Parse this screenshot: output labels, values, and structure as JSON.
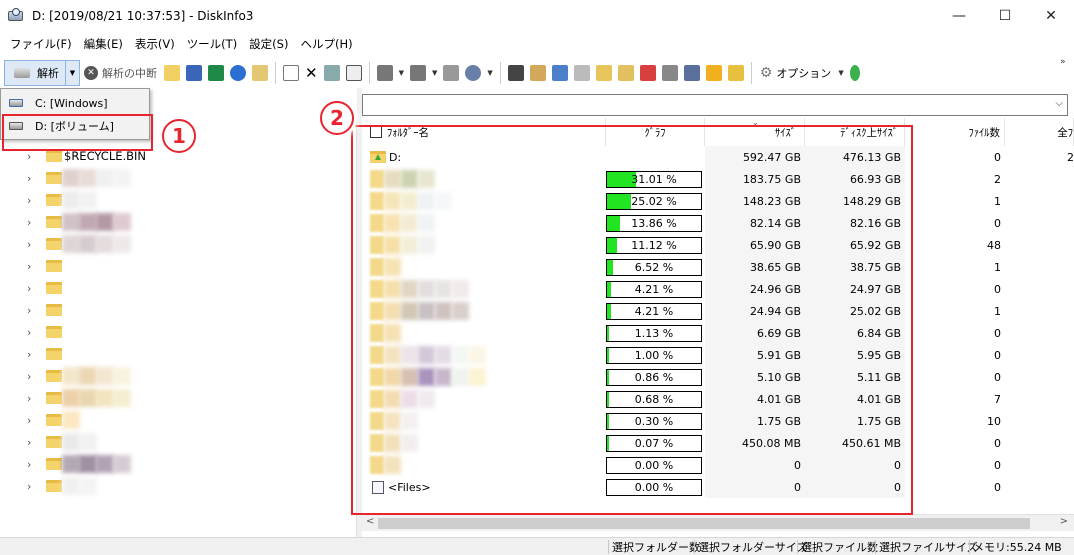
{
  "window": {
    "title": "D: [2019/08/21 10:37:53] - DiskInfo3",
    "minimize": "—",
    "maximize": "☐",
    "close": "✕"
  },
  "menu": [
    "ファイル(F)",
    "編集(E)",
    "表示(V)",
    "ツール(T)",
    "設定(S)",
    "ヘルプ(H)"
  ],
  "toolbar": {
    "analyze": "解析",
    "stop": "解析の中断",
    "options": "オプション"
  },
  "drive_menu": {
    "items": [
      "C: [Windows]",
      "D: [ボリューム]"
    ]
  },
  "annotations": {
    "one": "1",
    "two": "2"
  },
  "tree": {
    "items": [
      {
        "label": "$RECYCLE.BIN"
      }
    ]
  },
  "list": {
    "columns": {
      "name": "ﾌｫﾙﾀﾞｰ名",
      "graph": "ｸﾞﾗﾌ",
      "size": "ｻｲｽﾞ",
      "disk": "ﾃﾞｨｽｸ上ｻｲｽﾞ",
      "files": "ﾌｧｲﾙ数",
      "total": "全ﾌ"
    },
    "root": {
      "name": "D:",
      "size": "592.47 GB",
      "disk": "476.13 GB",
      "files": "0",
      "total": "2"
    },
    "rows": [
      {
        "percent": 31.01,
        "graph": "31.01 %",
        "size": "183.75 GB",
        "disk": "66.93 GB",
        "files": "2",
        "total": ""
      },
      {
        "percent": 25.02,
        "graph": "25.02 %",
        "size": "148.23 GB",
        "disk": "148.29 GB",
        "files": "1",
        "total": ""
      },
      {
        "percent": 13.86,
        "graph": "13.86 %",
        "size": "82.14 GB",
        "disk": "82.16 GB",
        "files": "0",
        "total": ""
      },
      {
        "percent": 11.12,
        "graph": "11.12 %",
        "size": "65.90 GB",
        "disk": "65.92 GB",
        "files": "48",
        "total": ""
      },
      {
        "percent": 6.52,
        "graph": "6.52 %",
        "size": "38.65 GB",
        "disk": "38.75 GB",
        "files": "1",
        "total": ""
      },
      {
        "percent": 4.21,
        "graph": "4.21 %",
        "size": "24.96 GB",
        "disk": "24.97 GB",
        "files": "0",
        "total": ""
      },
      {
        "percent": 4.21,
        "graph": "4.21 %",
        "size": "24.94 GB",
        "disk": "25.02 GB",
        "files": "1",
        "total": ""
      },
      {
        "percent": 1.13,
        "graph": "1.13 %",
        "size": "6.69 GB",
        "disk": "6.84 GB",
        "files": "0",
        "total": ""
      },
      {
        "percent": 1.0,
        "graph": "1.00 %",
        "size": "5.91 GB",
        "disk": "5.95 GB",
        "files": "0",
        "total": ""
      },
      {
        "percent": 0.86,
        "graph": "0.86 %",
        "size": "5.10 GB",
        "disk": "5.11 GB",
        "files": "0",
        "total": ""
      },
      {
        "percent": 0.68,
        "graph": "0.68 %",
        "size": "4.01 GB",
        "disk": "4.01 GB",
        "files": "7",
        "total": ""
      },
      {
        "percent": 0.3,
        "graph": "0.30 %",
        "size": "1.75 GB",
        "disk": "1.75 GB",
        "files": "10",
        "total": ""
      },
      {
        "percent": 0.07,
        "graph": "0.07 %",
        "size": "450.08 MB",
        "disk": "450.61 MB",
        "files": "0",
        "total": ""
      },
      {
        "percent": 0.0,
        "graph": "0.00 %",
        "size": "0",
        "disk": "0",
        "files": "0",
        "total": ""
      }
    ],
    "files_row": {
      "name": "<Files>",
      "percent": 0.0,
      "graph": "0.00 %",
      "size": "0",
      "disk": "0",
      "files": "0",
      "total": ""
    }
  },
  "status": {
    "sel_folders": "選択フォルダー数",
    "sel_folder_size": "選択フォルダーサイズ",
    "sel_files": "選択ファイル数",
    "sel_file_size": "選択ファイルサイズ",
    "memory": "メモリ:55.24 MB"
  },
  "colors": {
    "bar": "#23e423",
    "annotation": "#e8252e"
  }
}
